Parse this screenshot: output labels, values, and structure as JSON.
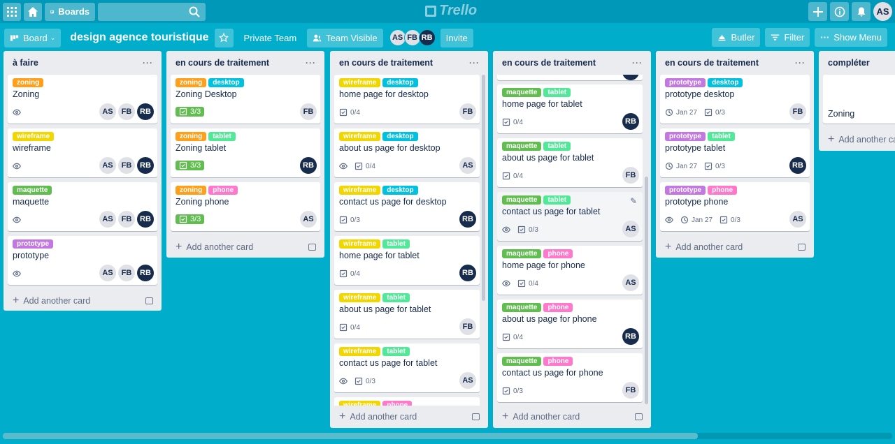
{
  "topbar": {
    "boards_label": "Boards",
    "logo": "Trello",
    "user": "AS"
  },
  "board": {
    "view_label": "Board",
    "title": "design agence touristique",
    "team": "Private Team",
    "visibility": "Team Visible",
    "members": [
      "AS",
      "FB",
      "RB"
    ],
    "invite": "Invite",
    "butler": "Butler",
    "filter": "Filter",
    "show_menu": "Show Menu"
  },
  "colors": {
    "orange": "#ff9f1a",
    "blue": "#00c2e0",
    "yellow": "#f2d600",
    "green": "#61bd4f",
    "lime": "#51e898",
    "pink": "#ff78cb",
    "purple": "#c377e0"
  },
  "lists": [
    {
      "title": "à faire",
      "add_label": "Add another card",
      "cards": [
        {
          "labels": [
            {
              "text": "zoning",
              "color": "#ff9f1a"
            }
          ],
          "title": "Zoning",
          "watch": true,
          "members": [
            "AS",
            "FB",
            "RB"
          ]
        },
        {
          "labels": [
            {
              "text": "wireframe",
              "color": "#f2d600"
            }
          ],
          "title": "wireframe",
          "watch": true,
          "members": [
            "AS",
            "FB",
            "RB"
          ]
        },
        {
          "labels": [
            {
              "text": "maquette",
              "color": "#61bd4f"
            }
          ],
          "title": "maquette",
          "watch": true,
          "members": [
            "AS",
            "FB",
            "RB"
          ]
        },
        {
          "labels": [
            {
              "text": "prototype",
              "color": "#c377e0"
            }
          ],
          "title": "prototype",
          "watch": true,
          "members": [
            "AS",
            "FB",
            "RB"
          ]
        }
      ]
    },
    {
      "title": "en cours de traitement",
      "add_label": "Add another card",
      "cards": [
        {
          "labels": [
            {
              "text": "zoning",
              "color": "#ff9f1a"
            },
            {
              "text": "desktop",
              "color": "#00c2e0"
            }
          ],
          "title": "Zoning Desktop",
          "checklist": "3/3",
          "complete": true,
          "members": [
            "FB"
          ]
        },
        {
          "labels": [
            {
              "text": "zoning",
              "color": "#ff9f1a"
            },
            {
              "text": "tablet",
              "color": "#51e898"
            }
          ],
          "title": "Zoning tablet",
          "checklist": "3/3",
          "complete": true,
          "members": [
            "RB"
          ]
        },
        {
          "labels": [
            {
              "text": "zoning",
              "color": "#ff9f1a"
            },
            {
              "text": "phone",
              "color": "#ff78cb"
            }
          ],
          "title": "Zoning phone",
          "checklist": "3/3",
          "complete": true,
          "members": [
            "AS"
          ]
        }
      ]
    },
    {
      "title": "en cours de traitement",
      "add_label": "Add another card",
      "cards": [
        {
          "labels": [
            {
              "text": "wireframe",
              "color": "#f2d600"
            },
            {
              "text": "desktop",
              "color": "#00c2e0"
            }
          ],
          "title": "home page for desktop",
          "checklist": "0/4",
          "members": [
            "FB"
          ]
        },
        {
          "labels": [
            {
              "text": "wireframe",
              "color": "#f2d600"
            },
            {
              "text": "desktop",
              "color": "#00c2e0"
            }
          ],
          "title": "about us page for desktop",
          "watch": true,
          "checklist": "0/4",
          "members": [
            "AS"
          ]
        },
        {
          "labels": [
            {
              "text": "wireframe",
              "color": "#f2d600"
            },
            {
              "text": "desktop",
              "color": "#00c2e0"
            }
          ],
          "title": "contact us page for desktop",
          "checklist": "0/3",
          "members": [
            "RB"
          ]
        },
        {
          "labels": [
            {
              "text": "wireframe",
              "color": "#f2d600"
            },
            {
              "text": "tablet",
              "color": "#51e898"
            }
          ],
          "title": "home page for tablet",
          "checklist": "0/4",
          "members": [
            "RB"
          ]
        },
        {
          "labels": [
            {
              "text": "wireframe",
              "color": "#f2d600"
            },
            {
              "text": "tablet",
              "color": "#51e898"
            }
          ],
          "title": "about us page for tablet",
          "checklist": "0/4",
          "members": [
            "FB"
          ]
        },
        {
          "labels": [
            {
              "text": "wireframe",
              "color": "#f2d600"
            },
            {
              "text": "tablet",
              "color": "#51e898"
            }
          ],
          "title": "contact us page for tablet",
          "watch": true,
          "checklist": "0/3",
          "members": [
            "AS"
          ]
        },
        {
          "labels": [
            {
              "text": "wireframe",
              "color": "#f2d600"
            },
            {
              "text": "phone",
              "color": "#ff78cb"
            }
          ],
          "title": "",
          "members": []
        }
      ]
    },
    {
      "title": "en cours de traitement",
      "add_label": "Add another card",
      "cards": [
        {
          "labels": [
            {
              "text": "maquette",
              "color": "#61bd4f"
            },
            {
              "text": "tablet",
              "color": "#51e898"
            }
          ],
          "title": "home page for tablet",
          "checklist": "0/4",
          "members": [
            "RB"
          ]
        },
        {
          "labels": [
            {
              "text": "maquette",
              "color": "#61bd4f"
            },
            {
              "text": "tablet",
              "color": "#51e898"
            }
          ],
          "title": "about us page for tablet",
          "checklist": "0/4",
          "members": [
            "FB"
          ]
        },
        {
          "labels": [
            {
              "text": "maquette",
              "color": "#61bd4f"
            },
            {
              "text": "tablet",
              "color": "#51e898"
            }
          ],
          "title": "contact us page for tablet",
          "watch": true,
          "checklist": "0/3",
          "members": [
            "AS"
          ]
        },
        {
          "labels": [
            {
              "text": "maquette",
              "color": "#61bd4f"
            },
            {
              "text": "phone",
              "color": "#ff78cb"
            }
          ],
          "title": "home page for phone",
          "watch": true,
          "checklist": "0/4",
          "members": [
            "AS"
          ]
        },
        {
          "labels": [
            {
              "text": "maquette",
              "color": "#61bd4f"
            },
            {
              "text": "phone",
              "color": "#ff78cb"
            }
          ],
          "title": "about us page for phone",
          "checklist": "0/4",
          "members": [
            "RB"
          ]
        },
        {
          "labels": [
            {
              "text": "maquette",
              "color": "#61bd4f"
            },
            {
              "text": "phone",
              "color": "#ff78cb"
            }
          ],
          "title": "contact us page for phone",
          "checklist": "0/3",
          "members": [
            "FB"
          ]
        }
      ]
    },
    {
      "title": "en cours de traitement",
      "add_label": "Add another card",
      "cards": [
        {
          "labels": [
            {
              "text": "prototype",
              "color": "#c377e0"
            },
            {
              "text": "desktop",
              "color": "#00c2e0"
            }
          ],
          "title": "prototype desktop",
          "due": "Jan 27",
          "checklist": "0/3",
          "members": [
            "FB"
          ]
        },
        {
          "labels": [
            {
              "text": "prototype",
              "color": "#c377e0"
            },
            {
              "text": "tablet",
              "color": "#51e898"
            }
          ],
          "title": "prototype tablet",
          "due": "Jan 27",
          "checklist": "0/3",
          "members": [
            "RB"
          ]
        },
        {
          "labels": [
            {
              "text": "prototype",
              "color": "#c377e0"
            },
            {
              "text": "phone",
              "color": "#ff78cb"
            }
          ],
          "title": "prototype phone",
          "watch": true,
          "due": "Jan 27",
          "checklist": "0/3",
          "members": [
            "AS"
          ]
        }
      ]
    },
    {
      "title": "compléter",
      "add_label": "Add another ca",
      "cards": [
        {
          "labels": [],
          "title": "Zoning",
          "members": []
        }
      ]
    }
  ]
}
